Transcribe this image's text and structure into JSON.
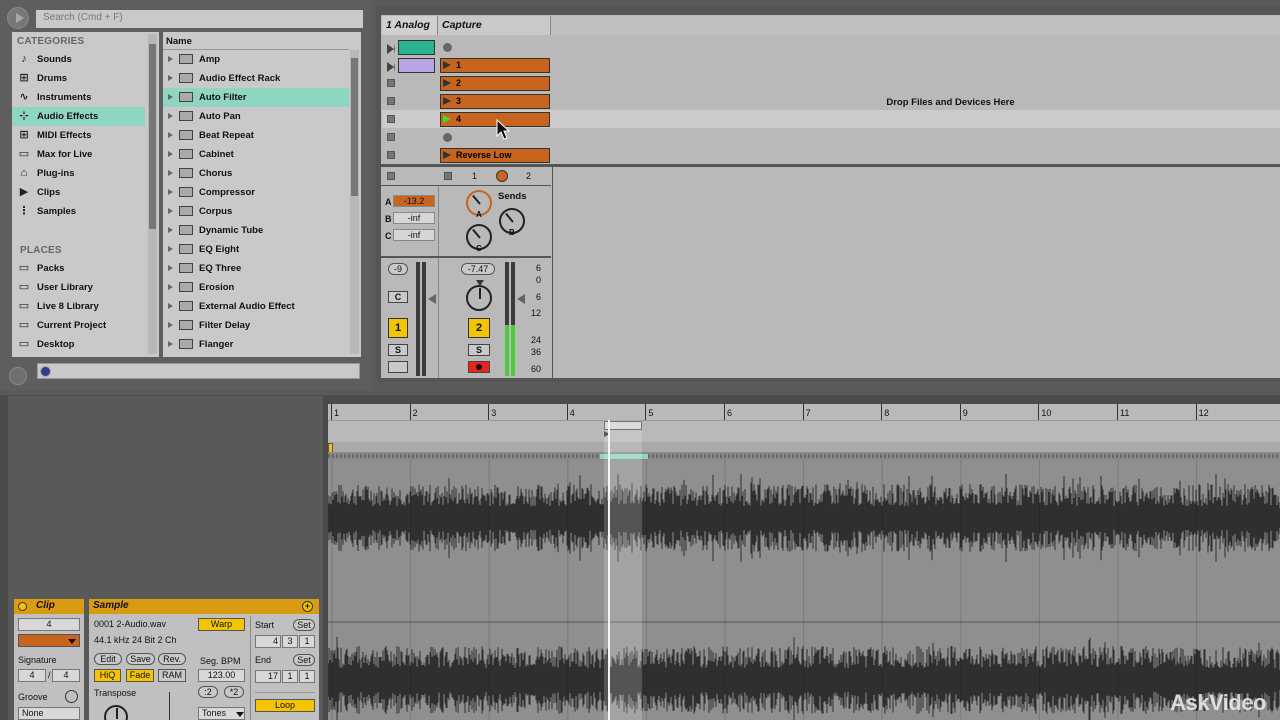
{
  "browser": {
    "search_placeholder": "Search (Cmd + F)",
    "categories_title": "CATEGORIES",
    "categories": [
      {
        "label": "Sounds",
        "icon": "note-icon"
      },
      {
        "label": "Drums",
        "icon": "grid-icon"
      },
      {
        "label": "Instruments",
        "icon": "wave-icon"
      },
      {
        "label": "Audio Effects",
        "icon": "audio-fx-icon",
        "selected": true
      },
      {
        "label": "MIDI Effects",
        "icon": "midi-fx-icon"
      },
      {
        "label": "Max for Live",
        "icon": "max-icon"
      },
      {
        "label": "Plug-ins",
        "icon": "plug-icon"
      },
      {
        "label": "Clips",
        "icon": "clip-icon"
      },
      {
        "label": "Samples",
        "icon": "sample-icon"
      }
    ],
    "places_title": "PLACES",
    "places": [
      {
        "label": "Packs"
      },
      {
        "label": "User Library"
      },
      {
        "label": "Live 8 Library"
      },
      {
        "label": "Current Project"
      },
      {
        "label": "Desktop"
      }
    ],
    "name_header": "Name",
    "items": [
      "Amp",
      "Audio Effect Rack",
      "Auto Filter",
      "Auto Pan",
      "Beat Repeat",
      "Cabinet",
      "Chorus",
      "Compressor",
      "Corpus",
      "Dynamic Tube",
      "EQ Eight",
      "EQ Three",
      "Erosion",
      "External Audio Effect",
      "Filter Delay",
      "Flanger"
    ],
    "selected_item": "Auto Filter"
  },
  "session": {
    "track1_title": "1 Analog",
    "track2_title": "Capture",
    "clip_labels": [
      "1",
      "2",
      "3",
      "4",
      "Reverse Low"
    ],
    "drop_text": "Drop Files and Devices Here",
    "sends_label": "Sends",
    "return_labels": [
      "1",
      "2"
    ],
    "sends": [
      {
        "label": "A",
        "value": "-13.2"
      },
      {
        "label": "B",
        "value": "-inf"
      },
      {
        "label": "C",
        "value": "-inf"
      }
    ],
    "knob_labels": [
      "A",
      "B",
      "C"
    ],
    "track1_volume": "-9",
    "track2_volume": "-7.47",
    "track1_pan": "C",
    "track1_number": "1",
    "track2_number": "2",
    "solo_label": "S",
    "meter_scale": [
      "6",
      "0",
      "6",
      "12",
      "24",
      "36",
      "60"
    ],
    "track2_meter_level": 0.45
  },
  "arrangement": {
    "bars": [
      "1",
      "2",
      "3",
      "4",
      "5",
      "6",
      "7",
      "8",
      "9",
      "10",
      "11",
      "12"
    ]
  },
  "clip_panel": {
    "title": "Clip",
    "clip_name": "4",
    "signature_label": "Signature",
    "sig_num": "4",
    "sig_den": "4",
    "groove_label": "Groove",
    "groove_value": "None"
  },
  "sample_panel": {
    "title": "Sample",
    "file_name": "0001 2-Audio.wav",
    "file_info": "44.1 kHz 24 Bit 2 Ch",
    "warp": "Warp",
    "edit": "Edit",
    "save": "Save",
    "rev": "Rev.",
    "hiq": "HiQ",
    "fade": "Fade",
    "ram": "RAM",
    "seg_bpm_label": "Seg. BPM",
    "seg_bpm": "123.00",
    "half": ":2",
    "double": "*2",
    "transpose_label": "Transpose",
    "tones": "Tones",
    "start_label": "Start",
    "start_values": [
      "4",
      "3",
      "1"
    ],
    "end_label": "End",
    "end_values": [
      "17",
      "1",
      "1"
    ],
    "set_label": "Set",
    "loop": "Loop"
  },
  "watermark": "AskVideo",
  "colors": {
    "accent_teal": "#8fd6c2",
    "clip_orange": "#c7641d",
    "panel_gold": "#d89b12",
    "button_yellow": "#f2c500",
    "meter_green": "#4ccc3a"
  }
}
